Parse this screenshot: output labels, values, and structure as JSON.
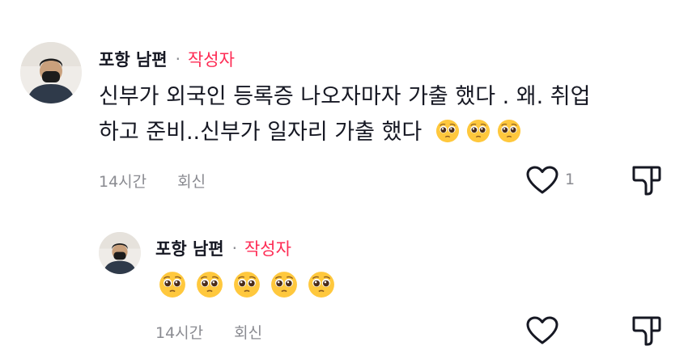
{
  "comment": {
    "author_name": "포항 남편",
    "separator": "·",
    "author_tag": "작성자",
    "text_line1": "신부가 외국인 등록증 나오자마자 가출 했다 . 왜. 취업",
    "text_line2": "하고 준비..신부가 일자리 가출 했다",
    "emojis": [
      "pleading-face",
      "pleading-face",
      "pleading-face"
    ],
    "time": "14시간",
    "reply_label": "회신",
    "like_count": "1"
  },
  "reply": {
    "author_name": "포항 남편",
    "separator": "·",
    "author_tag": "작성자",
    "emojis": [
      "pleading-face",
      "pleading-face",
      "pleading-face",
      "pleading-face",
      "pleading-face"
    ],
    "time": "14시간",
    "reply_label": "회신"
  },
  "colors": {
    "author_tag": "#fe2c55",
    "meta_text": "#8a8b91",
    "primary_text": "#161823"
  }
}
